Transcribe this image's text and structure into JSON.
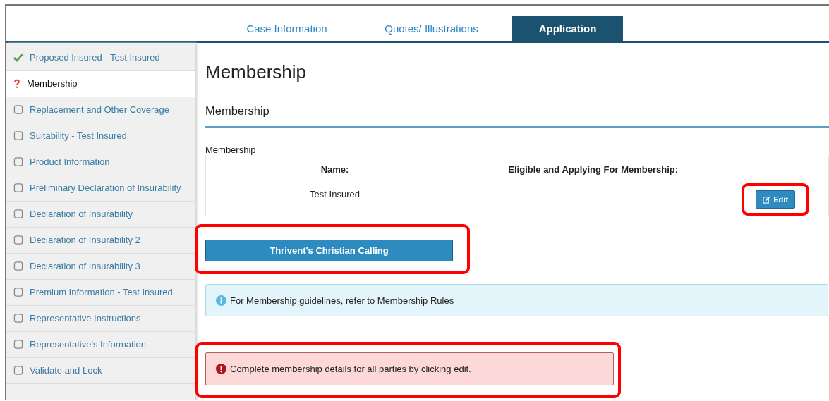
{
  "tabs": [
    {
      "label": "Case Information",
      "selected": false
    },
    {
      "label": "Quotes/ Illustrations",
      "selected": false
    },
    {
      "label": "Application",
      "selected": true
    }
  ],
  "sidebar": {
    "items": [
      {
        "label": "Proposed Insured - Test Insured",
        "kind": "complete",
        "selected": false
      },
      {
        "label": "Membership",
        "kind": "incomplete",
        "selected": true
      },
      {
        "label": "Replacement and Other Coverage",
        "kind": "pending",
        "selected": false
      },
      {
        "label": "Suitability - Test Insured",
        "kind": "pending",
        "selected": false
      },
      {
        "label": "Product Information",
        "kind": "pending",
        "selected": false
      },
      {
        "label": "Preliminary Declaration of Insurability",
        "kind": "pending",
        "selected": false
      },
      {
        "label": "Declaration of Insurability",
        "kind": "pending",
        "selected": false
      },
      {
        "label": "Declaration of Insurability 2",
        "kind": "pending",
        "selected": false
      },
      {
        "label": "Declaration of Insurability 3",
        "kind": "pending",
        "selected": false
      },
      {
        "label": "Premium Information - Test Insured",
        "kind": "pending",
        "selected": false
      },
      {
        "label": "Representative Instructions",
        "kind": "pending",
        "selected": false
      },
      {
        "label": "Representative's Information",
        "kind": "pending",
        "selected": false
      },
      {
        "label": "Validate and Lock",
        "kind": "pending",
        "selected": false
      }
    ]
  },
  "page": {
    "title": "Membership",
    "section_title": "Membership",
    "table_label": "Membership",
    "table": {
      "columns": [
        "Name:",
        "Eligible and Applying For Membership:"
      ],
      "rows": [
        {
          "name": "Test Insured",
          "action": "Edit",
          "highlighted": true
        }
      ]
    },
    "calling_button": {
      "label": "Thrivent's Christian Calling",
      "highlighted": true
    },
    "info": {
      "text": "For Membership guidelines, refer to Membership Rules"
    },
    "error": {
      "text": "Complete membership details for all parties by clicking edit.",
      "highlighted": true
    }
  }
}
